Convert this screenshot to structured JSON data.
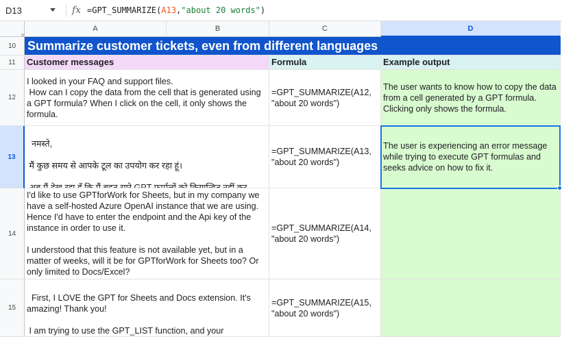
{
  "formula_bar": {
    "name_box": "D13",
    "fx_icon": "fx",
    "formula_prefix": "=GPT_SUMMARIZE(",
    "formula_ref": "A13",
    "formula_sep": ",",
    "formula_str": "\"about 20 words\"",
    "formula_suffix": ")"
  },
  "columns": [
    "A",
    "B",
    "C",
    "D"
  ],
  "rows": [
    "10",
    "11",
    "12",
    "13",
    "14",
    "15"
  ],
  "title": "Summarize customer tickets, even from different languages",
  "headers": {
    "messages": "Customer messages",
    "formula": "Formula",
    "output": "Example output"
  },
  "data_rows": [
    {
      "message": "I looked in your FAQ and support files.\n How can I copy the data from the cell that is generated using a GPT formula? When I click on the cell, it only shows the formula.",
      "formula": "=GPT_SUMMARIZE(A12,\n\"about 20 words\")",
      "output": "The user wants to know how to copy the data from a cell generated by a GPT formula. Clicking only shows the formula."
    },
    {
      "message": "नमस्ते,\n\n मैं कुछ समय से आपके टूल का उपयोग कर रहा हूं।\n\n अब मैं देख रहा हूँ कि मैं बहुत सारे GPT फ़ार्मूलों को क्रियान्वित नहीं कर सकता क्योंकि ऐसे पाठ निम्नलिखित संदेश है",
      "formula": "=GPT_SUMMARIZE(A13,\n\"about 20 words\")",
      "output": "The user is experiencing an error message while trying to execute GPT formulas and seeks advice on how to fix it."
    },
    {
      "message": "I'd like to use GPTforWork for Sheets, but in my company we have a self-hosted Azure OpenAI instance that we are using. Hence I'd have to enter the endpoint and the Api key of the instance in order to use it.\n\nI understood that this feature is not available yet, but in a matter of weeks, will it be for GPTforWork for Sheets too? Or only limited to Docs/Excel?",
      "formula": "=GPT_SUMMARIZE(A14,\n\"about 20 words\")",
      "output": ""
    },
    {
      "message": "First, I LOVE the GPT for Sheets and Docs extension. It's amazing! Thank you!\n\n I am trying to use the GPT_LIST function, and your documentation covers all the parameters well, but I can't",
      "formula": "=GPT_SUMMARIZE(A15,\n\"about 20 words\")",
      "output": ""
    }
  ]
}
